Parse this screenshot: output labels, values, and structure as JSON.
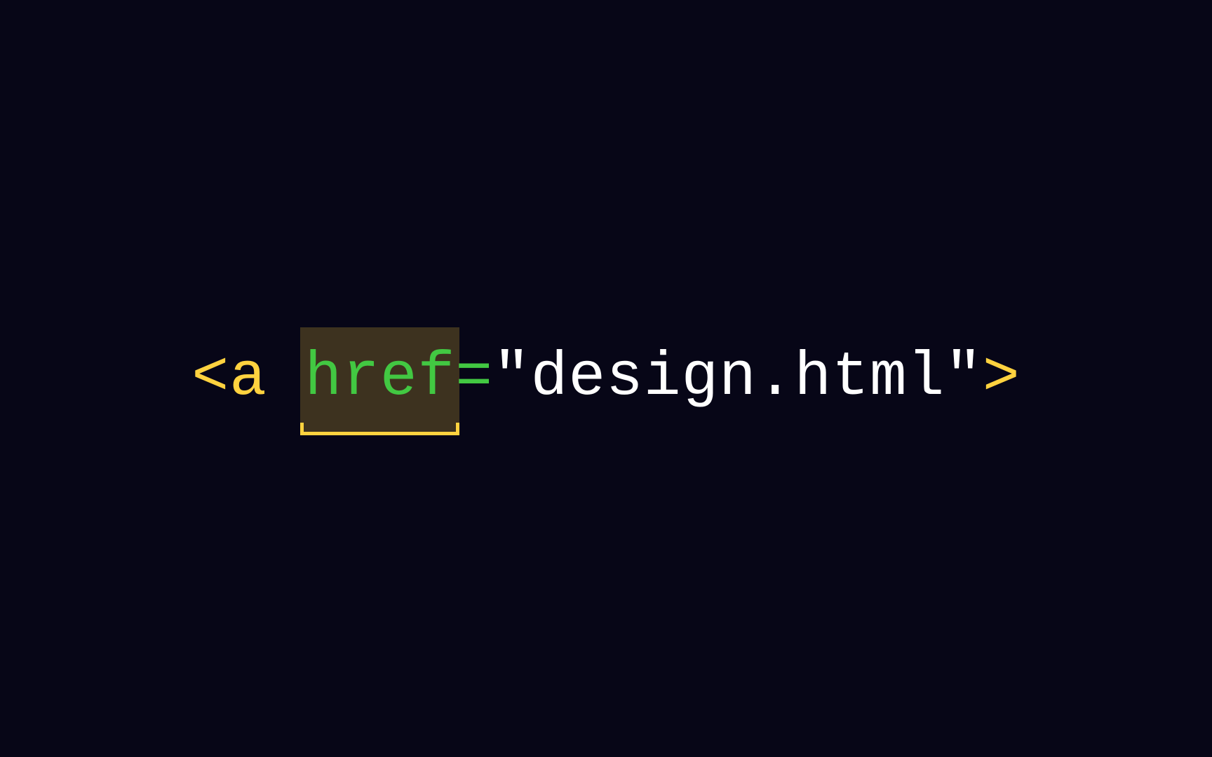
{
  "code": {
    "bracket_open": "<",
    "tag_name": "a",
    "space1": " ",
    "attr_name": "href",
    "equals": "=",
    "attr_value": "\"design.html\"",
    "bracket_close": ">"
  },
  "colors": {
    "background": "#070617",
    "punctuation": "#ffd23f",
    "tag": "#ffd23f",
    "attr_name": "#42c842",
    "string": "#ffffff",
    "highlight_bg": "rgba(255, 210, 63, 0.22)",
    "highlight_border": "#ffd23f"
  }
}
